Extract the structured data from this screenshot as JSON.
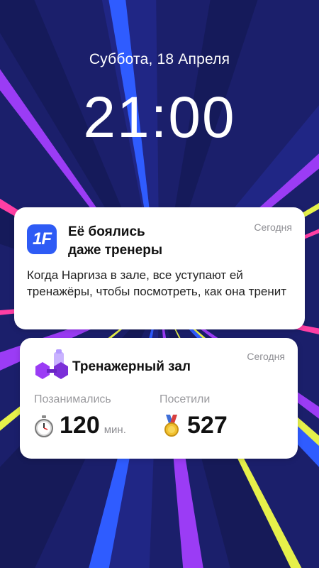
{
  "lockscreen": {
    "date": "Суббота, 18 Апреля",
    "time": "21:00"
  },
  "notifications": [
    {
      "app_icon_text": "1F",
      "title_line1": "Её боялись",
      "title_line2": "даже тренеры",
      "time": "Сегодня",
      "body": "Когда Наргиза в зале, все уступают ей тренажёры, чтобы посмотреть, как она тренит"
    }
  ],
  "widget": {
    "title": "Тренажерный зал",
    "time": "Сегодня",
    "stats": [
      {
        "label": "Позанимались",
        "value": "120",
        "unit": "мин.",
        "icon": "stopwatch-icon"
      },
      {
        "label": "Посетили",
        "value": "527",
        "unit": "",
        "icon": "medal-icon"
      }
    ]
  },
  "colors": {
    "background": "#1a1f6e",
    "accent_purple": "#9b3cf5",
    "accent_pink": "#ff3fa4",
    "accent_yellow": "#e6f04a",
    "accent_blue": "#2e5bf5"
  }
}
